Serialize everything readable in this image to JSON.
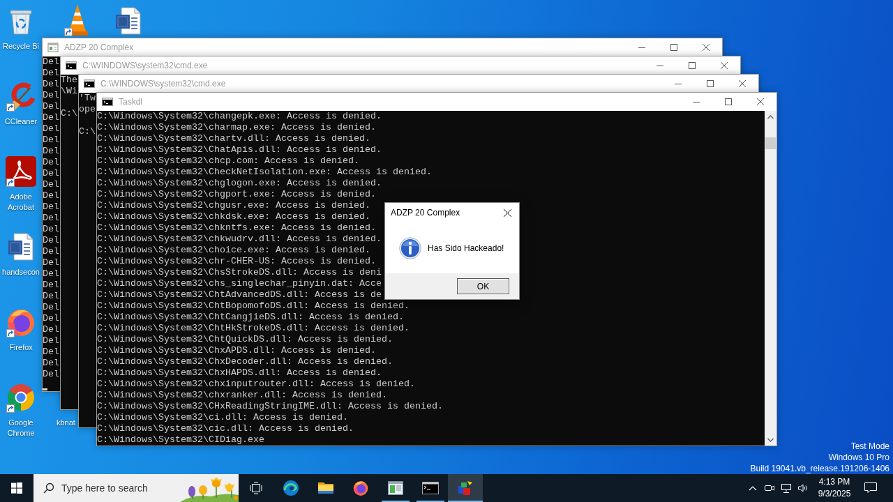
{
  "desktop_icons": [
    {
      "label": "Recycle Bi",
      "kind": "recycle-bin",
      "shortcut": false
    },
    {
      "label": "CCleaner",
      "kind": "ccleaner",
      "shortcut": true
    },
    {
      "label": "Adobe Acrobat",
      "kind": "acrobat",
      "shortcut": true
    },
    {
      "label": "handsecon",
      "kind": "word-doc",
      "shortcut": false
    },
    {
      "label": "Firefox",
      "kind": "firefox",
      "shortcut": true
    },
    {
      "label": "Google Chrome",
      "kind": "chrome",
      "shortcut": true
    }
  ],
  "desktop_icons_partial": [
    {
      "kind": "vlc",
      "shortcut": true
    },
    {
      "kind": "word-doc",
      "shortcut": false
    },
    {
      "label": "kbnat"
    }
  ],
  "windows": [
    {
      "kind": "app",
      "title": "ADZP 20 Complex",
      "active": false,
      "cursor": true,
      "output": [
        "Del",
        "Del",
        "Del",
        "Del",
        "Del",
        "Del",
        "Del",
        "Del",
        "Del",
        "Del",
        "Del",
        "Del",
        "Del",
        "Del",
        "Del",
        "Del",
        "Del",
        "Del",
        "Del",
        "Del",
        "Del",
        "Del",
        "Del",
        "Del",
        "Del",
        "Del",
        "Del",
        "Del",
        "Del"
      ]
    },
    {
      "kind": "cmd",
      "title": "C:\\WINDOWS\\system32\\cmd.exe",
      "active": false,
      "cursor": false,
      "output": [
        "The",
        "\\Wi"
      ],
      "prompt": "C:\\"
    },
    {
      "kind": "cmd",
      "title": "C:\\WINDOWS\\system32\\cmd.exe",
      "active": false,
      "cursor": false,
      "output": [
        "'Tw",
        "ope"
      ],
      "prompt": "C:\\"
    },
    {
      "kind": "cmd",
      "title": "Taskdl",
      "active": false,
      "cursor": false,
      "output": [
        "C:\\Windows\\System32\\changepk.exe: Access is denied.",
        "C:\\Windows\\System32\\charmap.exe: Access is denied.",
        "C:\\Windows\\System32\\chartv.dll: Access is denied.",
        "C:\\Windows\\System32\\ChatApis.dll: Access is denied.",
        "C:\\Windows\\System32\\chcp.com: Access is denied.",
        "C:\\Windows\\System32\\CheckNetIsolation.exe: Access is denied.",
        "C:\\Windows\\System32\\chglogon.exe: Access is denied.",
        "C:\\Windows\\System32\\chgport.exe: Access is denied.",
        "C:\\Windows\\System32\\chgusr.exe: Access is denied.",
        "C:\\Windows\\System32\\chkdsk.exe: Access is denied.",
        "C:\\Windows\\System32\\chkntfs.exe: Access is denied.",
        "C:\\Windows\\System32\\chkwudrv.dll: Access is denied.",
        "C:\\Windows\\System32\\choice.exe: Access is denied.",
        "C:\\Windows\\System32\\chr-CHER-US: Access is denied.",
        "C:\\Windows\\System32\\ChsStrokeDS.dll: Access is deni",
        "C:\\Windows\\System32\\chs_singlechar_pinyin.dat: Acce",
        "C:\\Windows\\System32\\ChtAdvancedDS.dll: Access is de",
        "C:\\Windows\\System32\\ChtBopomofoDS.dll: Access is denied.",
        "C:\\Windows\\System32\\ChtCangjieDS.dll: Access is denied.",
        "C:\\Windows\\System32\\ChtHkStrokeDS.dll: Access is denied.",
        "C:\\Windows\\System32\\ChtQuickDS.dll: Access is denied.",
        "C:\\Windows\\System32\\ChxAPDS.dll: Access is denied.",
        "C:\\Windows\\System32\\ChxDecoder.dll: Access is denied.",
        "C:\\Windows\\System32\\ChxHAPDS.dll: Access is denied.",
        "C:\\Windows\\System32\\chxinputrouter.dll: Access is denied.",
        "C:\\Windows\\System32\\chxranker.dll: Access is denied.",
        "C:\\Windows\\System32\\CHxReadingStringIME.dll: Access is denied.",
        "C:\\Windows\\System32\\ci.dll: Access is denied.",
        "C:\\Windows\\System32\\cic.dll: Access is denied.",
        "C:\\Windows\\System32\\CIDiag.exe"
      ]
    }
  ],
  "dialog": {
    "title": "ADZP 20 Complex",
    "active": true,
    "message": "Has Sido Hackeado!",
    "buttons": [
      "OK"
    ]
  },
  "system_notice": [
    "Test Mode",
    "Windows 10 Pro",
    "Build 19041.vb_release.191206-1406"
  ],
  "taskbar": {
    "search": {
      "placeholder": "Type here to search"
    },
    "buttons": [
      {
        "kind": "task-view",
        "running": false,
        "selected": false
      },
      {
        "kind": "edge",
        "running": false,
        "selected": false
      },
      {
        "kind": "explorer",
        "running": false,
        "selected": false
      },
      {
        "kind": "firefox",
        "running": false,
        "selected": false
      },
      {
        "kind": "app-window",
        "running": true,
        "selected": false
      },
      {
        "kind": "cmd",
        "running": true,
        "selected": false
      },
      {
        "kind": "cubes",
        "running": true,
        "selected": true
      }
    ],
    "clock": {
      "time": "4:13 PM",
      "date": "9/3/2025"
    }
  }
}
